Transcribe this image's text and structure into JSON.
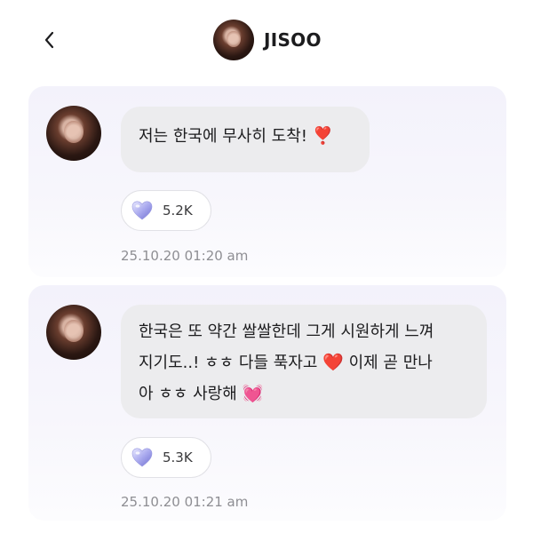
{
  "header": {
    "title": "JISOO",
    "back_icon": "chevron-left-icon"
  },
  "messages": [
    {
      "text": "저는 한국에 무사히 도착!",
      "emoji": "❣️",
      "reaction_icon": "purple-heart-icon",
      "reaction_count": "5.2K",
      "timestamp": "25.10.20 01:20 am"
    },
    {
      "line1": "한국은 또 약간 쌀쌀한데 그게 시원하게 느껴",
      "line2a": "지기도..! ㅎㅎ 다들 푹자고",
      "line2_emoji": "❤️",
      "line2b": "이제 곧 만나",
      "line3": "아 ㅎㅎ 사랑해",
      "line3_emoji": "💓",
      "reaction_icon": "purple-heart-icon",
      "reaction_count": "5.3K",
      "timestamp": "25.10.20 01:21 am"
    }
  ],
  "colors": {
    "bubble": "#ececee",
    "timestamp": "#8e8e93",
    "reaction_heart": "#b7b7f0"
  }
}
